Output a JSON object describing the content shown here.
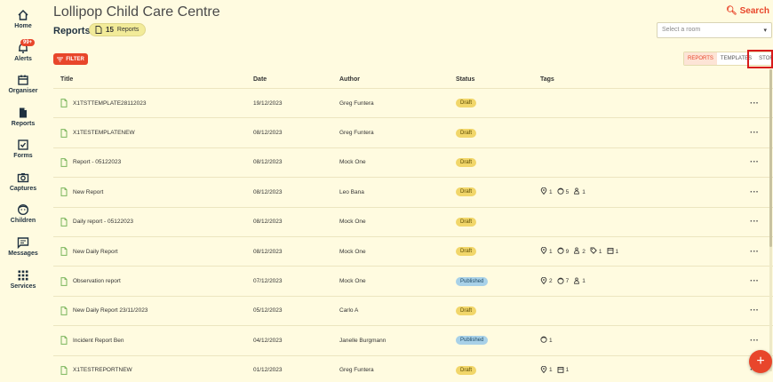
{
  "sidebar": {
    "items": [
      {
        "label": "Home",
        "icon": "home-icon"
      },
      {
        "label": "Alerts",
        "icon": "bell-icon",
        "badge": "99+"
      },
      {
        "label": "Organiser",
        "icon": "calendar-icon"
      },
      {
        "label": "Reports",
        "icon": "document-icon"
      },
      {
        "label": "Forms",
        "icon": "checkbox-icon"
      },
      {
        "label": "Captures",
        "icon": "camera-icon"
      },
      {
        "label": "Children",
        "icon": "child-face-icon"
      },
      {
        "label": "Messages",
        "icon": "message-icon"
      },
      {
        "label": "Services",
        "icon": "grid-icon"
      }
    ]
  },
  "header": {
    "app_title": "Lollipop Child Care Centre",
    "search_label": "Search",
    "page_title": "Reports",
    "count": "15",
    "count_label": "Reports",
    "room_placeholder": "Select a room"
  },
  "toolbar": {
    "filter_label": "FILTER",
    "tabs": [
      "REPORTS",
      "TEMPLATES",
      "STORIES"
    ],
    "active_tab": "REPORTS"
  },
  "table": {
    "headers": {
      "title": "Title",
      "date": "Date",
      "author": "Author",
      "status": "Status",
      "tags": "Tags"
    },
    "rows": [
      {
        "title": "X1TSTTEMPLATE28112023",
        "date": "19/12/2023",
        "author": "Greg Funtera",
        "status": "Draft",
        "tags": []
      },
      {
        "title": "X1TESTEMPLATENEW",
        "date": "08/12/2023",
        "author": "Greg Funtera",
        "status": "Draft",
        "tags": []
      },
      {
        "title": "Report - 05122023",
        "date": "08/12/2023",
        "author": "Mock One",
        "status": "Draft",
        "tags": []
      },
      {
        "title": "New Report",
        "date": "08/12/2023",
        "author": "Leo Bana",
        "status": "Draft",
        "tags": [
          {
            "icon": "pin-icon",
            "count": "1"
          },
          {
            "icon": "child-face-icon",
            "count": "5"
          },
          {
            "icon": "baby-icon",
            "count": "1"
          }
        ]
      },
      {
        "title": "Daily report - 05122023",
        "date": "08/12/2023",
        "author": "Mock One",
        "status": "Draft",
        "tags": []
      },
      {
        "title": "New Daily Report",
        "date": "08/12/2023",
        "author": "Mock One",
        "status": "Draft",
        "tags": [
          {
            "icon": "pin-icon",
            "count": "1"
          },
          {
            "icon": "child-face-icon",
            "count": "9"
          },
          {
            "icon": "baby-icon",
            "count": "2"
          },
          {
            "icon": "tag-icon",
            "count": "1"
          },
          {
            "icon": "calendar-icon",
            "count": "1"
          }
        ]
      },
      {
        "title": "Observation report",
        "date": "07/12/2023",
        "author": "Mock One",
        "status": "Published",
        "tags": [
          {
            "icon": "pin-icon",
            "count": "2"
          },
          {
            "icon": "child-face-icon",
            "count": "7"
          },
          {
            "icon": "baby-icon",
            "count": "1"
          }
        ]
      },
      {
        "title": "New Daily Report 23/11/2023",
        "date": "05/12/2023",
        "author": "Carlo A",
        "status": "Draft",
        "tags": []
      },
      {
        "title": "Incident Report Ben",
        "date": "04/12/2023",
        "author": "Janelle Burgmann",
        "status": "Published",
        "tags": [
          {
            "icon": "child-face-icon",
            "count": "1"
          }
        ]
      },
      {
        "title": "X1TESTREPORTNEW",
        "date": "01/12/2023",
        "author": "Greg Funtera",
        "status": "Draft",
        "tags": [
          {
            "icon": "pin-icon",
            "count": "1"
          },
          {
            "icon": "calendar-icon",
            "count": "1"
          }
        ]
      }
    ]
  },
  "fab_label": "+",
  "colors": {
    "accent": "#e8462b",
    "background": "#fffbe0",
    "draft": "#f1d66a",
    "published": "#a8d1e8",
    "highlight": "#d81b1b"
  }
}
